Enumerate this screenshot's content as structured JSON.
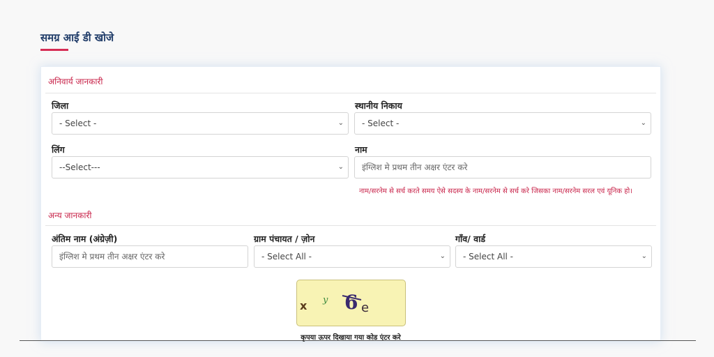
{
  "page": {
    "title": "समग्र आई डी खोजे"
  },
  "mandatory": {
    "heading": "अनिवार्य जानकारी",
    "district": {
      "label": "जिला",
      "value": "- Select -"
    },
    "local_body": {
      "label": "स्थानीय निकाय",
      "value": "- Select -"
    },
    "gender": {
      "label": "लिंग",
      "value": "--Select---"
    },
    "name": {
      "label": "नाम",
      "placeholder": "इंग्लिश मे प्रथम तीन अक्षर एंटर करे"
    },
    "hint": "नाम/सरनेम से सर्च करते समय ऐसे सदस्य के नाम/सरनेम से सर्च करे जिसका नाम/सरनेम सरल एवं यूनिक हो।"
  },
  "other": {
    "heading": "अन्य जानकारी",
    "last_name": {
      "label": "अंतिम नाम (अंग्रेज़ी)",
      "placeholder": "इंग्लिश मे प्रथम तीन अक्षर एंटर करे"
    },
    "gram_panchayat": {
      "label": "ग्राम पंचायत / ज़ोन",
      "value": "- Select All -"
    },
    "village": {
      "label": "गाँव/ वार्ड",
      "value": "- Select All -"
    }
  },
  "captcha": {
    "instruction": "कृपया ऊपर दिखाया गया कोड एंटर करे",
    "chars": [
      "x",
      "y",
      "6",
      "e"
    ]
  },
  "colors": {
    "accent": "#c8244a",
    "title": "#1f3b68",
    "captcha_bg": "#f8f3b4"
  }
}
